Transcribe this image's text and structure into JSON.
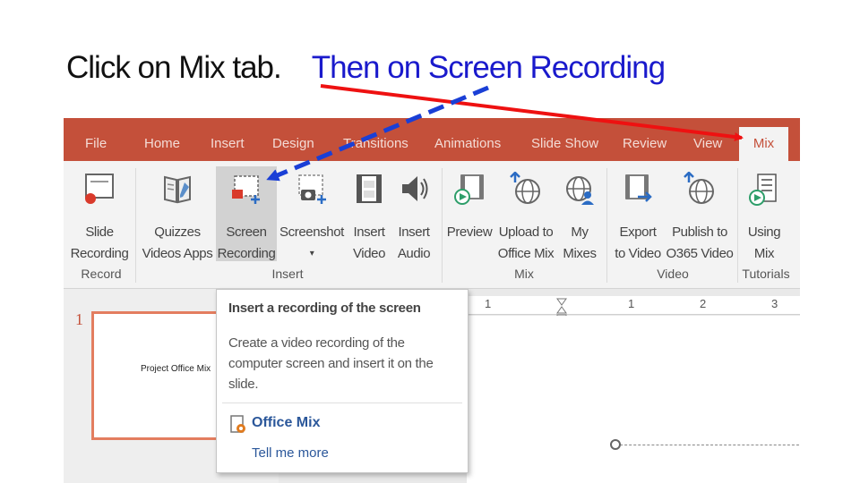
{
  "slide": {
    "instruction_part1": "Click on Mix tab.",
    "instruction_part2": "Then on Screen Recording"
  },
  "ribbon_tabs": [
    "File",
    "Home",
    "Insert",
    "Design",
    "Transitions",
    "Animations",
    "Slide Show",
    "Review",
    "View",
    "Mix"
  ],
  "ribbon_buttons": {
    "slide_recording": [
      "Slide",
      "Recording"
    ],
    "quizzes": [
      "Quizzes",
      "Videos Apps"
    ],
    "screen_recording": [
      "Screen",
      "Recording"
    ],
    "screenshot": [
      "Screenshot",
      "▾"
    ],
    "insert_video": [
      "Insert",
      "Video"
    ],
    "insert_audio": [
      "Insert",
      "Audio"
    ],
    "preview": [
      "Preview",
      ""
    ],
    "upload": [
      "Upload to",
      "Office Mix"
    ],
    "my_mixes": [
      "My",
      "Mixes"
    ],
    "export": [
      "Export",
      "to Video"
    ],
    "publish": [
      "Publish to",
      "O365 Video"
    ],
    "using_mix": [
      "Using",
      "Mix"
    ]
  },
  "ribbon_groups": [
    "Record",
    "Insert",
    "Mix",
    "Video",
    "Tutorials"
  ],
  "thumbnail": {
    "number": "1",
    "text": "Project Office Mix"
  },
  "ruler_labels": [
    "1",
    "1",
    "2",
    "3"
  ],
  "tooltip": {
    "title": "Insert a recording of the screen",
    "description": "Create a video recording of the computer screen and insert it on the slide.",
    "addin_name": "Office Mix",
    "link": "Tell me more"
  },
  "colors": {
    "tab_bar": "#c4503a",
    "arrow_red": "#ee1111",
    "arrow_blue": "#1a3fd6",
    "instruction_blue": "#1a1acc"
  }
}
